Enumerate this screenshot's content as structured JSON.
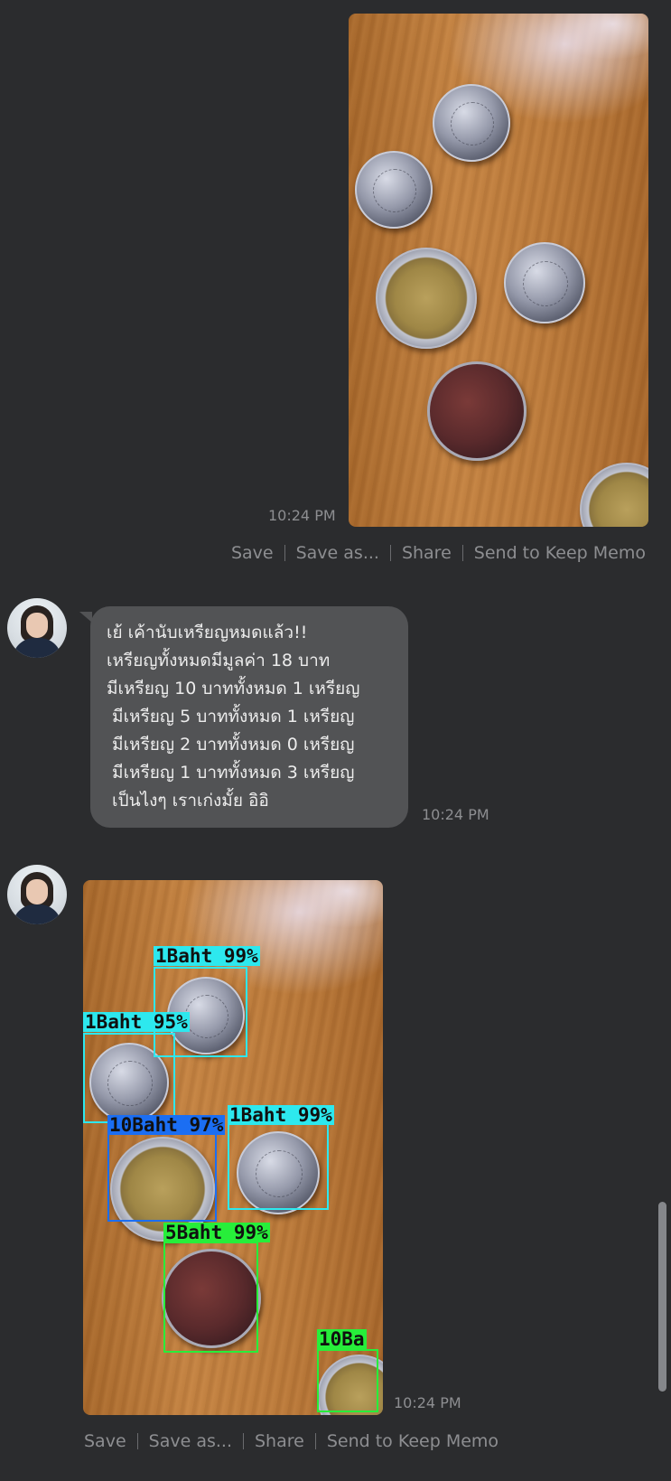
{
  "colors": {
    "background": "#2b2c2e",
    "bubble": "#525355",
    "muted_text": "#8d8e91",
    "box_cyan": "#2de8ee",
    "box_blue": "#1b6ef3",
    "box_green": "#27ee3a"
  },
  "messages": {
    "sent_photo": {
      "time": "10:24 PM",
      "actions": [
        "Save",
        "Save as...",
        "Share",
        "Send to Keep Memo"
      ]
    },
    "reply_text": {
      "lines": [
        "เย้ เค้านับเหรียญหมดแล้ว!!",
        "เหรียญทั้งหมดมีมูลค่า 18 บาท",
        "มีเหรียญ 10 บาททั้งหมด 1 เหรียญ",
        " มีเหรียญ 5 บาททั้งหมด 1 เหรียญ",
        " มีเหรียญ 2 บาททั้งหมด 0 เหรียญ",
        " มีเหรียญ 1 บาททั้งหมด 3 เหรียญ",
        " เป็นไงๆ เราเก่งมั้ย อิอิ"
      ],
      "time": "10:24 PM"
    },
    "reply_photo": {
      "detections": [
        {
          "label": "1Baht 99%"
        },
        {
          "label": "1Baht 95%"
        },
        {
          "label": "10Baht 97%"
        },
        {
          "label": "1Baht 99%"
        },
        {
          "label": "5Baht 99%"
        },
        {
          "label": "10Ba"
        }
      ],
      "time": "10:24 PM",
      "actions": [
        "Save",
        "Save as...",
        "Share",
        "Send to Keep Memo"
      ]
    }
  },
  "icons": {
    "avatar": "user-avatar-icon"
  }
}
